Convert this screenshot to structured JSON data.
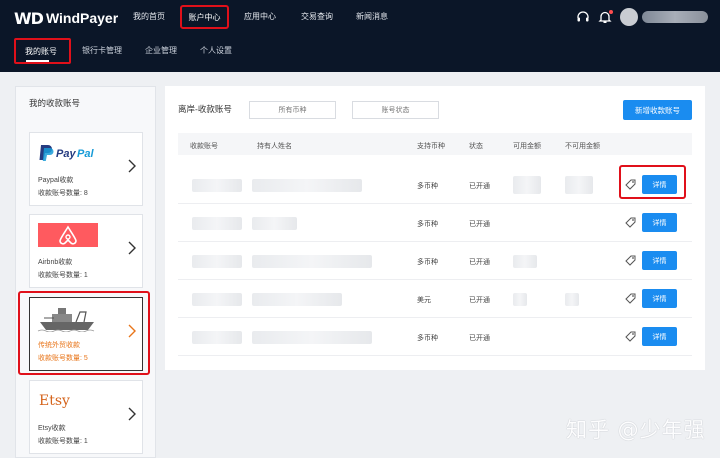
{
  "brand": {
    "logo_mark": "WD",
    "name": "WindPayer"
  },
  "nav": {
    "home": "我的首页",
    "account_center": "账户中心",
    "app_center": "应用中心",
    "transactions": "交易查询",
    "news": "新闻消息"
  },
  "subnav": {
    "my_account": "我的账号",
    "bank_cards": "银行卡管理",
    "company": "企业管理",
    "settings": "个人设置"
  },
  "sidebar": {
    "title": "我的收款账号",
    "cards": [
      {
        "logo": "PayPal",
        "name": "Paypal收款",
        "count": "收款账号数量: 8"
      },
      {
        "logo": "airbnb",
        "name": "Airbnb收款",
        "count": "收款账号数量: 1"
      },
      {
        "logo": "ship",
        "name": "传统外贸收款",
        "count": "收款账号数量: 5"
      },
      {
        "logo": "Etsy",
        "name": "Etsy收款",
        "count": "收款账号数量: 1"
      }
    ]
  },
  "main": {
    "title": "离岸-收款账号",
    "filter_currency": "所有币种",
    "filter_status": "账号状态",
    "add_button": "新增收款账号",
    "columns": [
      "收款账号",
      "持有人姓名",
      "支持币种",
      "状态",
      "可用金额",
      "不可用金额"
    ],
    "rows": [
      {
        "currency": "多币种",
        "status": "已开通",
        "action": "详情"
      },
      {
        "currency": "多币种",
        "status": "已开通",
        "action": "详情"
      },
      {
        "currency": "多币种",
        "status": "已开通",
        "action": "详情"
      },
      {
        "currency": "美元",
        "status": "已开通",
        "action": "详情"
      },
      {
        "currency": "多币种",
        "status": "已开通",
        "action": "详情"
      }
    ]
  },
  "watermark": "知乎 @少年强",
  "colors": {
    "nav_bg": "#0b1628",
    "primary": "#1a8cf0",
    "highlight": "#e0101a",
    "selected_text": "#e8751a"
  }
}
